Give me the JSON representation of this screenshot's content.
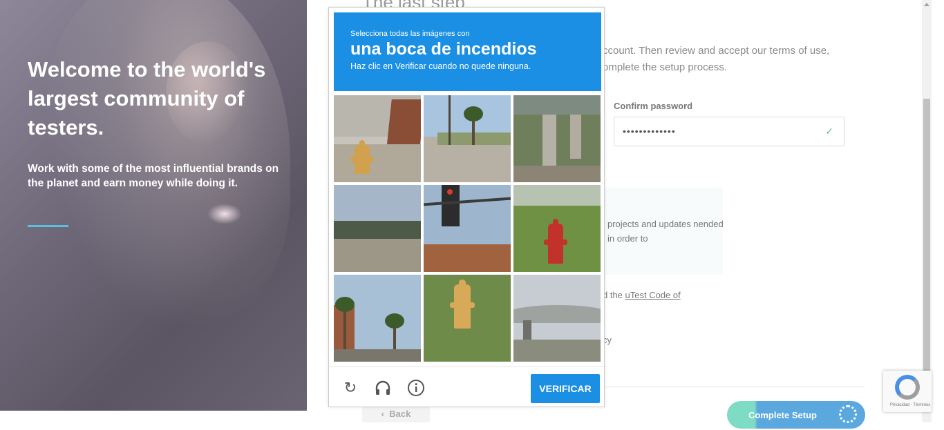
{
  "hero": {
    "headline": "Welcome to the world's largest community of testers.",
    "subtext": "Work with some of the most influential brands on the planet and earn money while doing it.",
    "accent_color": "#5bbfe0"
  },
  "form": {
    "step_title": "The last step",
    "intro": "ccount. Then review and accept our terms of use, omplete the setup process.",
    "confirm_password": {
      "label": "Confirm password",
      "value": "•••••••••••••",
      "valid_icon": "check-icon"
    },
    "info_text": "projects and updates nended in order to",
    "code_line_prefix": "d the ",
    "code_link": "uTest Code of",
    "policy_fragment": "cy",
    "back_label": "Back",
    "complete_label": "Complete Setup"
  },
  "captcha": {
    "instruction_pre": "Selecciona todas las imágenes con",
    "object": "una boca de incendios",
    "instruction_post": "Haz clic en Verificar cuando no quede ninguna.",
    "header_color": "#1a8fe3",
    "tiles": [
      {
        "scene": "hydrant-by-wall",
        "has_hydrant": true
      },
      {
        "scene": "street-palm-pole",
        "has_hydrant": false
      },
      {
        "scene": "bridge-pillars",
        "has_hydrant": false
      },
      {
        "scene": "fence-field",
        "has_hydrant": false
      },
      {
        "scene": "traffic-light",
        "has_hydrant": false
      },
      {
        "scene": "hydrant-red-grass",
        "has_hydrant": true
      },
      {
        "scene": "palms-buildings",
        "has_hydrant": false
      },
      {
        "scene": "hydrant-yellow-grass",
        "has_hydrant": true
      },
      {
        "scene": "overpass-water",
        "has_hydrant": false
      }
    ],
    "icons": [
      "reload-icon",
      "headphones-icon",
      "info-icon"
    ],
    "verify_label": "VERIFICAR"
  },
  "recaptcha_badge": {
    "links": "Privacidad - Términos"
  }
}
